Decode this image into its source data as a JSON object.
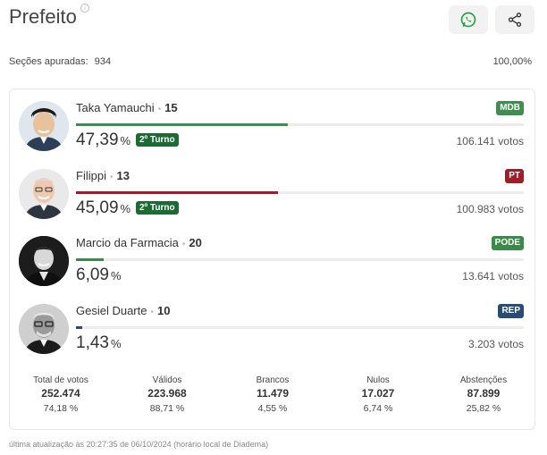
{
  "header": {
    "title": "Prefeito",
    "info_icon": "info-icon",
    "whatsapp_icon": "whatsapp-icon",
    "share_icon": "share-icon"
  },
  "summary": {
    "sections_label": "Seções apuradas:",
    "sections_value": "934",
    "percent_counted": "100,00%"
  },
  "candidates": [
    {
      "name": "Taka Yamauchi",
      "number": "15",
      "party": "MDB",
      "party_color": "#3e8e4f",
      "bar_color": "#3e8e4f",
      "percent": "47,39",
      "percent_value": 47.39,
      "unit": "%",
      "second_round": "2º Turno",
      "votes": "106.141 votos"
    },
    {
      "name": "Filippi",
      "number": "13",
      "party": "PT",
      "party_color": "#a01c27",
      "bar_color": "#a01c27",
      "percent": "45,09",
      "percent_value": 45.09,
      "unit": "%",
      "second_round": "2º Turno",
      "votes": "100.983 votos"
    },
    {
      "name": "Marcio da Farmacia",
      "number": "20",
      "party": "PODE",
      "party_color": "#3c8a4a",
      "bar_color": "#3c8a4a",
      "percent": "6,09",
      "percent_value": 6.09,
      "unit": "%",
      "second_round": "",
      "votes": "13.641 votos"
    },
    {
      "name": "Gesiel Duarte",
      "number": "10",
      "party": "REP",
      "party_color": "#274d74",
      "bar_color": "#274d74",
      "percent": "1,43",
      "percent_value": 1.43,
      "unit": "%",
      "second_round": "",
      "votes": "3.203 votos"
    }
  ],
  "stats": [
    {
      "label": "Total de votos",
      "value": "252.474",
      "percent": "74,18 %"
    },
    {
      "label": "Válidos",
      "value": "223.968",
      "percent": "88,71 %"
    },
    {
      "label": "Brancos",
      "value": "11.479",
      "percent": "4,55 %"
    },
    {
      "label": "Nulos",
      "value": "17.027",
      "percent": "6,74 %"
    },
    {
      "label": "Abstenções",
      "value": "87.899",
      "percent": "25,82 %"
    }
  ],
  "footer": "última atualização às 20:27:35 de 06/10/2024 (horário local de Diadema)"
}
